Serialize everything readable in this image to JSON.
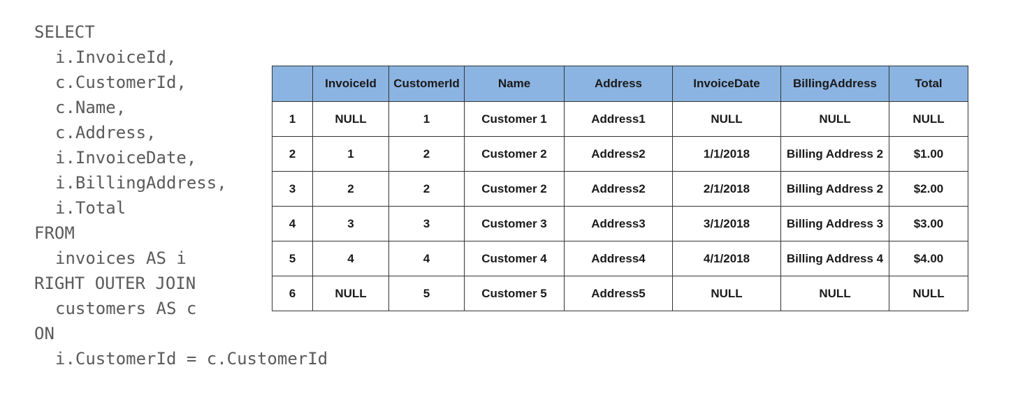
{
  "sql": {
    "lines": [
      {
        "text": "SELECT",
        "indent": false
      },
      {
        "text": "i.InvoiceId,",
        "indent": true
      },
      {
        "text": "c.CustomerId,",
        "indent": true
      },
      {
        "text": "c.Name,",
        "indent": true
      },
      {
        "text": "c.Address,",
        "indent": true
      },
      {
        "text": "i.InvoiceDate,",
        "indent": true
      },
      {
        "text": "i.BillingAddress,",
        "indent": true
      },
      {
        "text": "i.Total",
        "indent": true
      },
      {
        "text": "FROM",
        "indent": false
      },
      {
        "text": "invoices AS i",
        "indent": true
      },
      {
        "text": "RIGHT OUTER JOIN",
        "indent": false
      },
      {
        "text": "customers AS c",
        "indent": true
      },
      {
        "text": "ON",
        "indent": false
      },
      {
        "text": "i.CustomerId = c.CustomerId",
        "indent": true
      }
    ]
  },
  "table": {
    "header_color": "#8cb4e2",
    "columns": [
      "",
      "InvoiceId",
      "CustomerId",
      "Name",
      "Address",
      "InvoiceDate",
      "BillingAddress",
      "Total"
    ],
    "rows": [
      [
        "1",
        "NULL",
        "1",
        "Customer 1",
        "Address1",
        "NULL",
        "NULL",
        "NULL"
      ],
      [
        "2",
        "1",
        "2",
        "Customer 2",
        "Address2",
        "1/1/2018",
        "Billing Address 2",
        "$1.00"
      ],
      [
        "3",
        "2",
        "2",
        "Customer 2",
        "Address2",
        "2/1/2018",
        "Billing Address 2",
        "$2.00"
      ],
      [
        "4",
        "3",
        "3",
        "Customer 3",
        "Address3",
        "3/1/2018",
        "Billing Address 3",
        "$3.00"
      ],
      [
        "5",
        "4",
        "4",
        "Customer 4",
        "Address4",
        "4/1/2018",
        "Billing Address 4",
        "$4.00"
      ],
      [
        "6",
        "NULL",
        "5",
        "Customer 5",
        "Address5",
        "NULL",
        "NULL",
        "NULL"
      ]
    ]
  }
}
